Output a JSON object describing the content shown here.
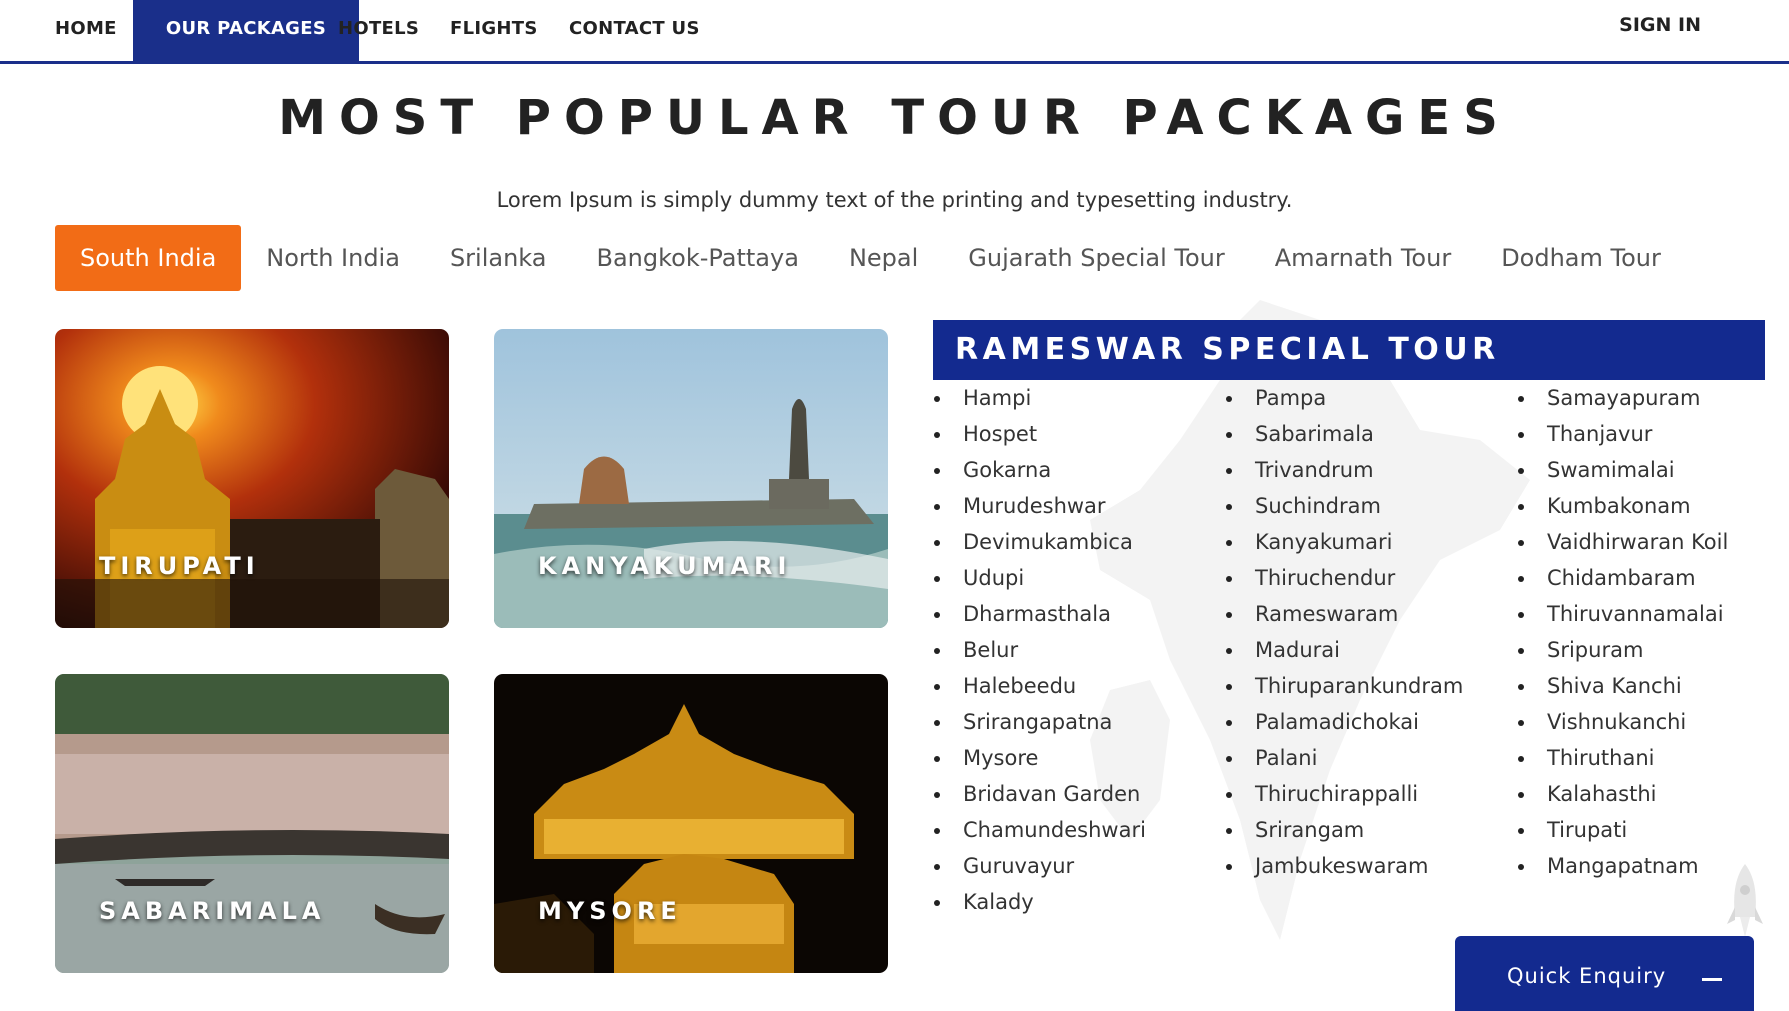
{
  "nav": {
    "items": [
      {
        "label": "HOME",
        "active": false
      },
      {
        "label": "OUR PACKAGES",
        "active": true
      },
      {
        "label": "HOTELS",
        "active": false
      },
      {
        "label": "FLIGHTS",
        "active": false
      },
      {
        "label": "CONTACT US",
        "active": false
      }
    ],
    "signin": "SIGN IN"
  },
  "heading": {
    "title": "MOST POPULAR TOUR PACKAGES",
    "subtitle": "Lorem Ipsum is simply dummy text of the printing and typesetting industry."
  },
  "tabs": [
    {
      "label": "South India",
      "active": true
    },
    {
      "label": "North India",
      "active": false
    },
    {
      "label": "Srilanka",
      "active": false
    },
    {
      "label": "Bangkok-Pattaya",
      "active": false
    },
    {
      "label": "Nepal",
      "active": false
    },
    {
      "label": "Gujarath Special Tour",
      "active": false
    },
    {
      "label": "Amarnath Tour",
      "active": false
    },
    {
      "label": "Dodham Tour",
      "active": false
    }
  ],
  "cards": [
    {
      "label": "TIRUPATI"
    },
    {
      "label": "KANYAKUMARI"
    },
    {
      "label": "SABARIMALA"
    },
    {
      "label": "MYSORE"
    }
  ],
  "tour": {
    "title": "RAMESWAR SPECIAL TOUR",
    "col1": [
      "Hampi",
      "Hospet",
      "Gokarna",
      "Murudeshwar",
      "Devimukambica",
      "Udupi",
      "Dharmasthala",
      "Belur",
      "Halebeedu",
      "Srirangapatna",
      "Mysore",
      "Bridavan Garden",
      "Chamundeshwari",
      "Guruvayur",
      "Kalady"
    ],
    "col2": [
      "Pampa",
      "Sabarimala",
      "Trivandrum",
      "Suchindram",
      "Kanyakumari",
      "Thiruchendur",
      "Rameswaram",
      "Madurai",
      "Thiruparankundram",
      "Palamadichokai",
      "Palani",
      "Thiruchirappalli",
      "Srirangam",
      "Jambukeswaram"
    ],
    "col3": [
      "Samayapuram",
      "Thanjavur",
      "Swamimalai",
      "Kumbakonam",
      "Vaidhirwaran Koil",
      "Chidambaram",
      "Thiruvannamalai",
      "Sripuram",
      "Shiva Kanchi",
      "Vishnukanchi",
      "Thiruthani",
      "Kalahasthi",
      "Tirupati",
      "Mangapatnam"
    ]
  },
  "enquiry": {
    "label": "Quick Enquiry"
  },
  "colors": {
    "primary": "#132a8f",
    "accent": "#f26c16"
  }
}
